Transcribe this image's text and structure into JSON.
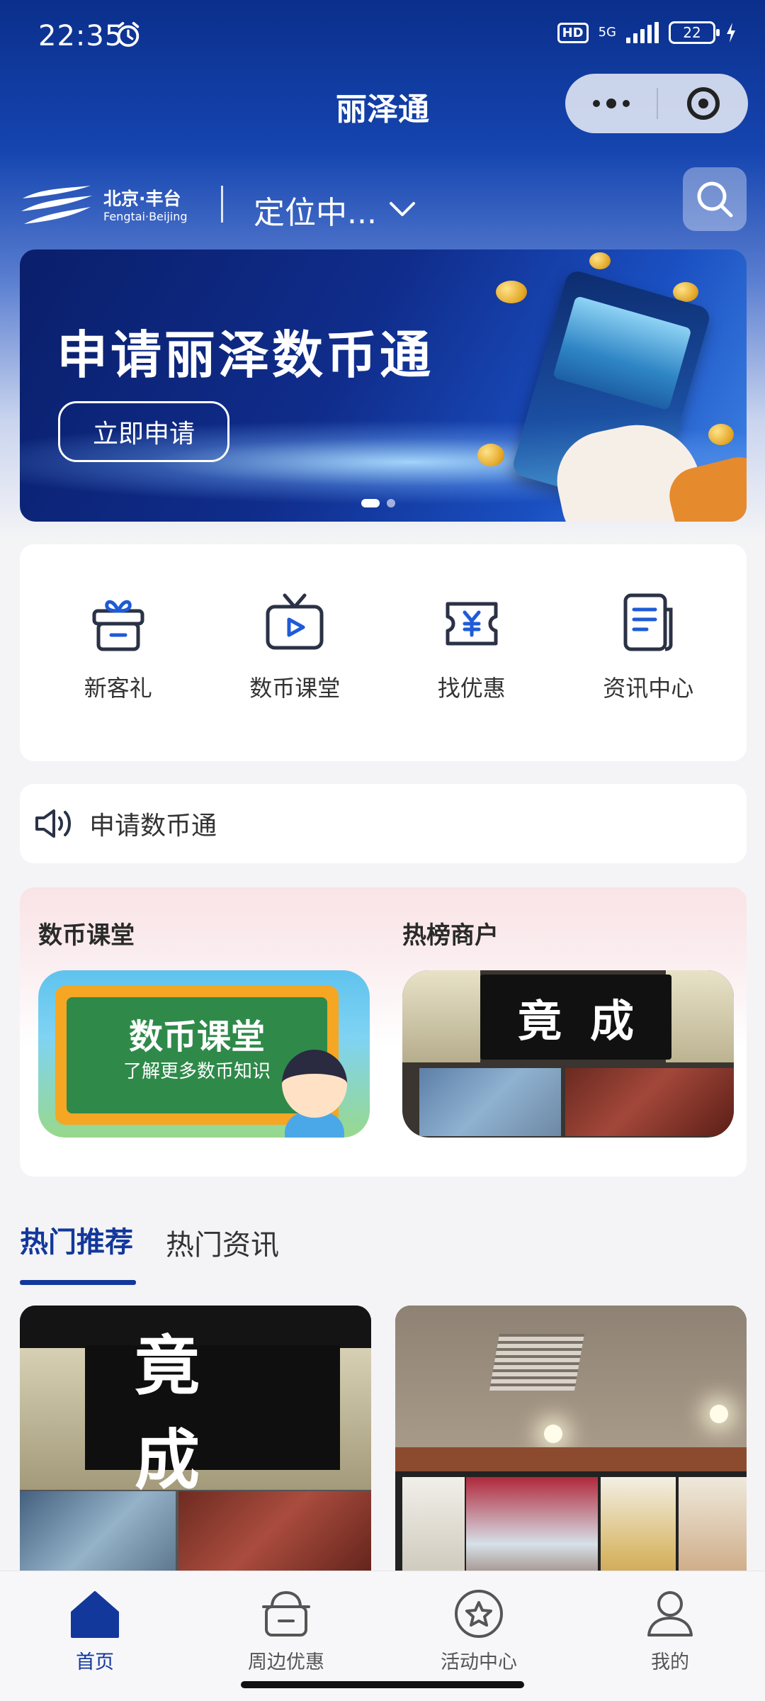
{
  "status_bar": {
    "time": "22:35",
    "hd_label": "HD",
    "network_label": "5G",
    "battery_percent": "22"
  },
  "nav": {
    "title": "丽泽通"
  },
  "location_bar": {
    "logo_zh": "北京·丰台",
    "logo_en": "Fengtai·Beijing",
    "location_text": "定位中..."
  },
  "banner": {
    "headline": "申请丽泽数币通",
    "cta_label": "立即申请",
    "slide_count": 2,
    "active_slide": 1
  },
  "quick_actions": [
    {
      "label": "新客礼",
      "icon": "gift-icon"
    },
    {
      "label": "数币课堂",
      "icon": "tv-play-icon"
    },
    {
      "label": "找优惠",
      "icon": "yuan-ticket-icon"
    },
    {
      "label": "资讯中心",
      "icon": "news-doc-icon"
    }
  ],
  "notice": {
    "text": "申请数币通",
    "icon": "speaker-icon"
  },
  "sections": {
    "left_title": "数币课堂",
    "left_image_title": "数币课堂",
    "left_image_subtitle": "了解更多数币知识",
    "right_title": "热榜商户",
    "right_sign_text": "竟成"
  },
  "feed_tabs": {
    "active": "热门推荐",
    "inactive": "热门资讯"
  },
  "feed_cards": {
    "card1_sign": "竟成"
  },
  "bottom_nav": [
    {
      "label": "首页",
      "icon": "home-icon",
      "active": true
    },
    {
      "label": "周边优惠",
      "icon": "nearby-deals-icon",
      "active": false
    },
    {
      "label": "活动中心",
      "icon": "star-badge-icon",
      "active": false
    },
    {
      "label": "我的",
      "icon": "user-icon",
      "active": false
    }
  ],
  "colors": {
    "brand_blue": "#12389b",
    "header_blue": "#0b2f8c",
    "battery_green": "#34d058"
  }
}
